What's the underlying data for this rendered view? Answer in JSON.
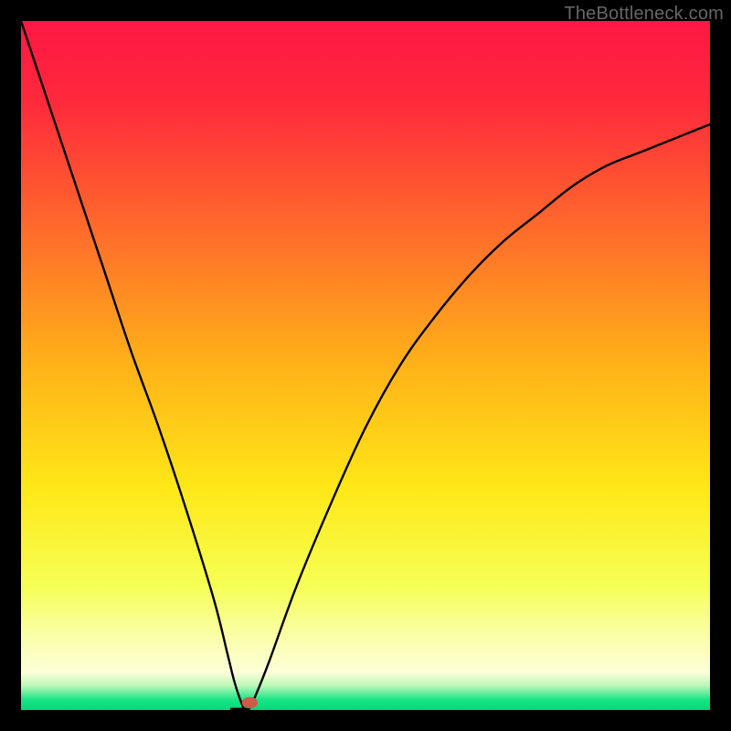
{
  "watermark": "TheBottleneck.com",
  "chart_data": {
    "type": "line",
    "title": "",
    "xlabel": "",
    "ylabel": "",
    "xlim": [
      0,
      100
    ],
    "ylim": [
      0,
      100
    ],
    "grid": false,
    "legend": false,
    "gradient_stops": [
      {
        "pos": 0.0,
        "color": "#ff1744"
      },
      {
        "pos": 0.12,
        "color": "#ff2a3c"
      },
      {
        "pos": 0.3,
        "color": "#ff6a2b"
      },
      {
        "pos": 0.5,
        "color": "#ffb218"
      },
      {
        "pos": 0.68,
        "color": "#ffe818"
      },
      {
        "pos": 0.82,
        "color": "#f6ff55"
      },
      {
        "pos": 0.9,
        "color": "#fbffb0"
      },
      {
        "pos": 0.945,
        "color": "#fdffd8"
      },
      {
        "pos": 0.965,
        "color": "#baf7b8"
      },
      {
        "pos": 0.985,
        "color": "#18e586"
      },
      {
        "pos": 1.0,
        "color": "#00d97a"
      }
    ],
    "series": [
      {
        "name": "bottleneck-curve",
        "x": [
          0,
          2,
          5,
          8,
          12,
          16,
          20,
          24,
          28,
          30,
          31,
          32,
          32.5,
          33,
          34,
          36,
          40,
          45,
          50,
          55,
          60,
          65,
          70,
          75,
          80,
          85,
          90,
          95,
          100
        ],
        "y": [
          100,
          94,
          85,
          76,
          64,
          52,
          41,
          29,
          16,
          8,
          4,
          1,
          0,
          0,
          2,
          7,
          18,
          30,
          41,
          50,
          57,
          63,
          68,
          72,
          76,
          79,
          81,
          83,
          85
        ]
      }
    ],
    "marker": {
      "x": 33.2,
      "y": 0.8,
      "color": "#d05a4a",
      "r": 1.1
    },
    "notch": {
      "x0": 30.5,
      "x1": 33.0,
      "y": 0
    }
  }
}
